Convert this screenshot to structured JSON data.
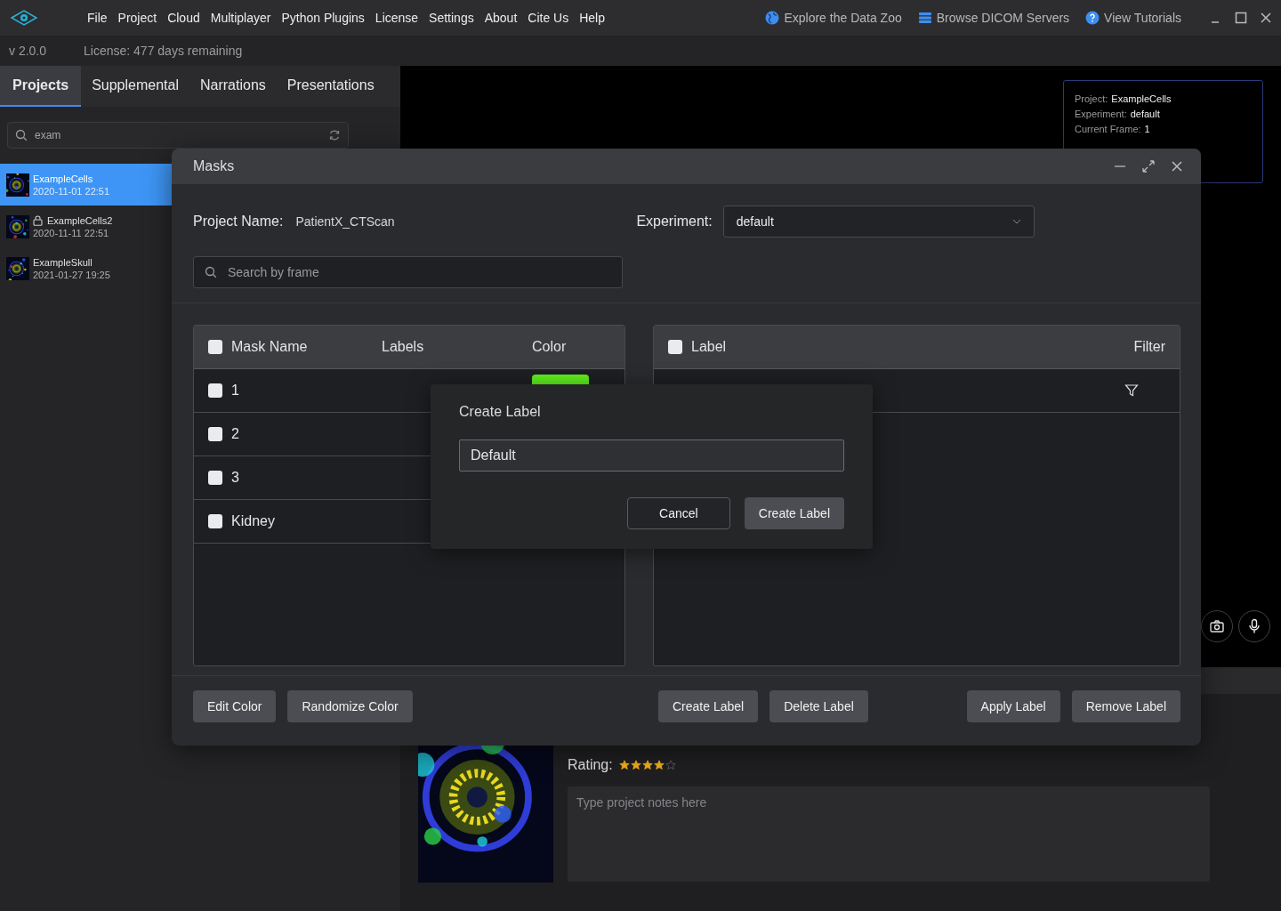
{
  "app": {
    "version": "v 2.0.0",
    "license": "License: 477 days remaining"
  },
  "menu": [
    "File",
    "Project",
    "Cloud",
    "Multiplayer",
    "Python Plugins",
    "License",
    "Settings",
    "About",
    "Cite Us",
    "Help"
  ],
  "top_links": [
    {
      "label": "Explore the Data Zoo",
      "kind": "globe"
    },
    {
      "label": "Browse DICOM Servers",
      "kind": "servers"
    },
    {
      "label": "View Tutorials",
      "kind": "help"
    }
  ],
  "sidebar": {
    "tabs": [
      {
        "label": "Projects",
        "selected": true
      },
      {
        "label": "Supplemental",
        "selected": false
      },
      {
        "label": "Narrations",
        "selected": false
      },
      {
        "label": "Presentations",
        "selected": false
      }
    ],
    "search": {
      "value": "exam"
    },
    "projects": [
      {
        "name": "ExampleCells",
        "date": "2020-11-01 22:51",
        "selected": true,
        "locked": false
      },
      {
        "name": "ExampleCells2",
        "date": "2020-11-11 22:51",
        "selected": false,
        "locked": true
      },
      {
        "name": "ExampleSkull",
        "date": "2021-01-27 19:25",
        "selected": false,
        "locked": false
      }
    ]
  },
  "viewer": {
    "info": [
      {
        "label": "Project:",
        "value": "ExampleCells"
      },
      {
        "label": "Experiment:",
        "value": "default"
      },
      {
        "label": "Current Frame:",
        "value": "1"
      }
    ]
  },
  "details": {
    "rating_label": "Rating:",
    "stars": 4,
    "notes": {
      "placeholder": "Type project notes here"
    }
  },
  "dialog": {
    "title": "Masks",
    "project_label": "Project Name:",
    "project_name": "PatientX_CTScan",
    "experiment_label": "Experiment:",
    "experiment": "default",
    "search": {
      "placeholder": "Search by frame"
    },
    "mask_table": {
      "header_checked": false,
      "columns": [
        "Mask Name",
        "Labels",
        "Color"
      ],
      "rows": [
        {
          "name": "1",
          "checked": false,
          "color": "#5ef01c"
        },
        {
          "name": "2",
          "checked": false
        },
        {
          "name": "3",
          "checked": false
        },
        {
          "name": "Kidney",
          "checked": false
        }
      ]
    },
    "label_table": {
      "header_checked": false,
      "columns": [
        "Label",
        "Filter"
      ]
    },
    "button_groups": [
      [
        "Edit Color",
        "Randomize Color"
      ],
      [
        "Create Label",
        "Delete Label"
      ],
      [
        "Apply Label",
        "Remove Label"
      ]
    ]
  },
  "create_label": {
    "title": "Create Label",
    "value": "Default",
    "buttons": [
      {
        "label": "Cancel",
        "kind": "secondary"
      },
      {
        "label": "Create Label",
        "kind": "primary"
      }
    ]
  }
}
